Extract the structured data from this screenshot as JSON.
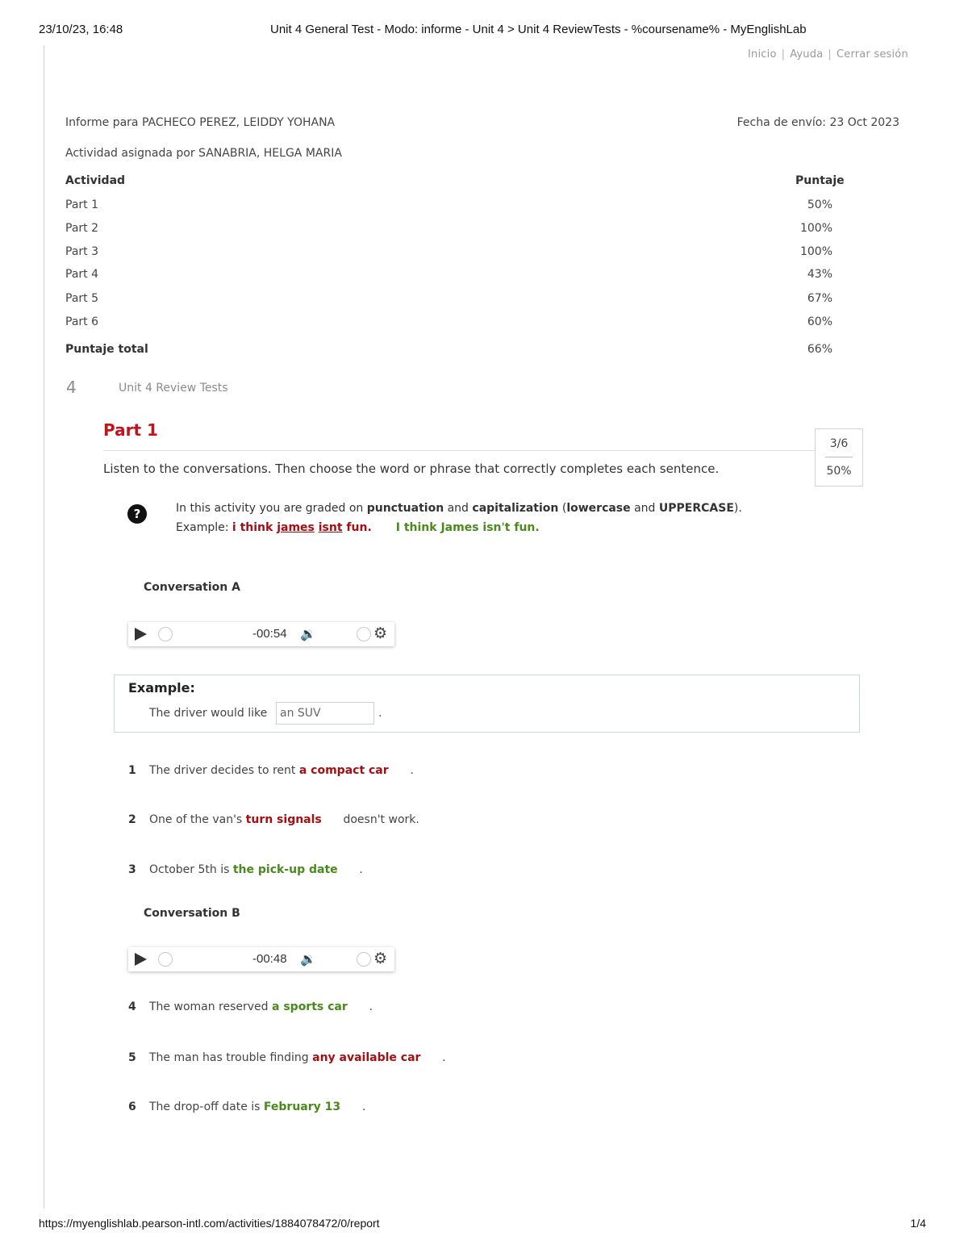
{
  "print_header": {
    "datetime": "23/10/23, 16:48",
    "title": "Unit 4 General Test - Modo: informe - Unit 4 > Unit 4 ReviewTests - %coursename% - MyEnglishLab"
  },
  "top_links": [
    "Inicio",
    "Ayuda",
    "Cerrar sesión"
  ],
  "report": {
    "student": "Informe para PACHECO PEREZ, LEIDDY YOHANA",
    "sent_date": "Fecha de envío: 23 Oct 2023",
    "assigned_by": "Actividad asignada por SANABRIA, HELGA MARIA",
    "col_activity": "Actividad",
    "col_score": "Puntaje",
    "rows": [
      {
        "name": "Part 1",
        "score": "50%"
      },
      {
        "name": "Part 2",
        "score": "100%"
      },
      {
        "name": "Part 3",
        "score": "100%"
      },
      {
        "name": "Part 4",
        "score": "43%"
      },
      {
        "name": "Part 5",
        "score": "67%"
      },
      {
        "name": "Part 6",
        "score": "60%"
      }
    ],
    "total_label": "Puntaje total",
    "total_score": "66%"
  },
  "unit": {
    "number": "4",
    "name": "Unit 4 Review Tests"
  },
  "part": {
    "title": "Part 1",
    "instructions": "Listen to the conversations. Then choose the word or phrase that correctly completes each sentence.",
    "score_fraction": "3/6",
    "score_percent": "50%"
  },
  "note": {
    "icon": "help-icon",
    "l1_a": "In this activity you are graded on ",
    "l1_b": "punctuation",
    "l1_c": " and ",
    "l1_d": "capitalization",
    "l1_e": " (",
    "l1_f": "lowercase",
    "l1_g": " and ",
    "l1_h": "UPPERCASE",
    "l1_i": ").",
    "l2_label": "Example: ",
    "w1": "i think ",
    "w2": "james",
    "w3": " ",
    "w4": "isnt",
    "w5": " fun.",
    "correct": "I think James isn't fun."
  },
  "conversation_a": {
    "label": "Conversation A",
    "time": "-00:54"
  },
  "conversation_b": {
    "label": "Conversation B",
    "time": "-00:48"
  },
  "example": {
    "title": "Example:",
    "text": "The driver would like",
    "answer": "an SUV",
    "end": "."
  },
  "questions": [
    {
      "num": "1",
      "before": "The driver decides to rent ",
      "answer": "a compact car",
      "after": "      .",
      "correct": false
    },
    {
      "num": "2",
      "before": "One of the van's ",
      "answer": "turn signals",
      "after": "      doesn't work.",
      "correct": false
    },
    {
      "num": "3",
      "before": "October 5th is ",
      "answer": "the pick-up date",
      "after": "      .",
      "correct": true
    },
    {
      "num": "4",
      "before": "The woman reserved ",
      "answer": "a sports car",
      "after": "      .",
      "correct": true
    },
    {
      "num": "5",
      "before": "The man has trouble finding ",
      "answer": "any available car",
      "after": "      .",
      "correct": false
    },
    {
      "num": "6",
      "before": "The drop-off date is ",
      "answer": "February 13",
      "after": "      .",
      "correct": true
    }
  ],
  "footer": {
    "url": "https://myenglishlab.pearson-intl.com/activities/1884078472/0/report",
    "page": "1/4"
  }
}
